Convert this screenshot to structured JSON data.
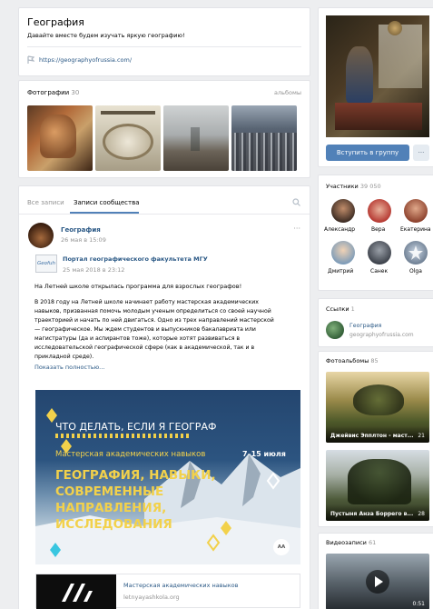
{
  "group": {
    "name": "География",
    "status": "Давайте вместе будем изучать яркую географию!",
    "site_link": "https://geographyofrussia.com/"
  },
  "photos": {
    "label": "Фотографии",
    "count": "30",
    "albums_link": "альбомы"
  },
  "wall": {
    "tabs": [
      "Все записи",
      "Записи сообщества"
    ],
    "post": {
      "author": "География",
      "date": "26 мая в 15:09",
      "repost_author": "Портал географического факультета МГУ",
      "repost_logo": "Geofuh",
      "repost_date": "25 мая 2018 в 23:12",
      "line1": "На Летней школе открылась программа для взрослых географов!",
      "body": [
        "В 2018 году на Летней школе начинает работу мастерская академических",
        "навыков, призванная помочь молодым ученым определиться со своей научной",
        "траекторией и начать по ней двигаться. Одно из трех направлений мастерской",
        "— географическое. Мы ждем студентов и выпускников бакалавриата или",
        "магистратуры (да и аспирантов тоже), которые хотят развиваться в",
        "исследовательской географической сфере (как в академической, так и в",
        "прикладной среде)."
      ],
      "show_more": "Показать полностью...",
      "banner": {
        "l1": "ЧТО ДЕЛАТЬ, ЕСЛИ Я ГЕОГРАФ",
        "l2": "Мастерская академических навыков",
        "dates": "7–15 июля",
        "l3": "ГЕОГРАФИЯ, НАВЫКИ,",
        "l4": "СОВРЕМЕННЫЕ",
        "l5": "НАПРАВЛЕНИЯ,",
        "l6": "ИССЛЕДОВАНИЯ",
        "corner": "AA"
      },
      "attach_title": "Мастерская академических навыков",
      "attach_url": "letnyayashkola.org"
    }
  },
  "right": {
    "join_button": "Вступить в группу",
    "more_button": "···",
    "members": {
      "label": "Участники",
      "count": "39 050",
      "people": [
        "Александр",
        "Вера",
        "Екатерина",
        "Дмитрий",
        "Санек",
        "Olga"
      ]
    },
    "links": {
      "label": "Ссылки",
      "count": "1",
      "title": "География",
      "url": "geographyofrussia.com"
    },
    "albums": {
      "label": "Фотоальбомы",
      "count": "85",
      "items": [
        {
          "title": "Джейвис Эпплтон - маст...",
          "count": "21"
        },
        {
          "title": "Пустыня Анза Боррего в...",
          "count": "28"
        }
      ]
    },
    "videos": {
      "label": "Видеозаписи",
      "count": "61",
      "duration": "0:51"
    }
  }
}
